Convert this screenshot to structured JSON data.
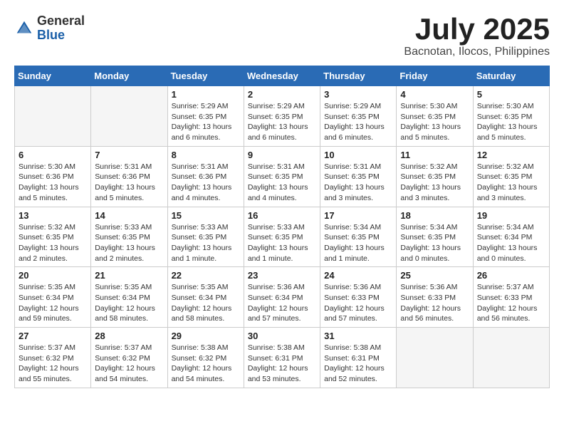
{
  "logo": {
    "general": "General",
    "blue": "Blue"
  },
  "title": "July 2025",
  "location": "Bacnotan, Ilocos, Philippines",
  "weekdays": [
    "Sunday",
    "Monday",
    "Tuesday",
    "Wednesday",
    "Thursday",
    "Friday",
    "Saturday"
  ],
  "weeks": [
    [
      {
        "day": "",
        "info": ""
      },
      {
        "day": "",
        "info": ""
      },
      {
        "day": "1",
        "info": "Sunrise: 5:29 AM\nSunset: 6:35 PM\nDaylight: 13 hours\nand 6 minutes."
      },
      {
        "day": "2",
        "info": "Sunrise: 5:29 AM\nSunset: 6:35 PM\nDaylight: 13 hours\nand 6 minutes."
      },
      {
        "day": "3",
        "info": "Sunrise: 5:29 AM\nSunset: 6:35 PM\nDaylight: 13 hours\nand 6 minutes."
      },
      {
        "day": "4",
        "info": "Sunrise: 5:30 AM\nSunset: 6:35 PM\nDaylight: 13 hours\nand 5 minutes."
      },
      {
        "day": "5",
        "info": "Sunrise: 5:30 AM\nSunset: 6:35 PM\nDaylight: 13 hours\nand 5 minutes."
      }
    ],
    [
      {
        "day": "6",
        "info": "Sunrise: 5:30 AM\nSunset: 6:36 PM\nDaylight: 13 hours\nand 5 minutes."
      },
      {
        "day": "7",
        "info": "Sunrise: 5:31 AM\nSunset: 6:36 PM\nDaylight: 13 hours\nand 5 minutes."
      },
      {
        "day": "8",
        "info": "Sunrise: 5:31 AM\nSunset: 6:36 PM\nDaylight: 13 hours\nand 4 minutes."
      },
      {
        "day": "9",
        "info": "Sunrise: 5:31 AM\nSunset: 6:35 PM\nDaylight: 13 hours\nand 4 minutes."
      },
      {
        "day": "10",
        "info": "Sunrise: 5:31 AM\nSunset: 6:35 PM\nDaylight: 13 hours\nand 3 minutes."
      },
      {
        "day": "11",
        "info": "Sunrise: 5:32 AM\nSunset: 6:35 PM\nDaylight: 13 hours\nand 3 minutes."
      },
      {
        "day": "12",
        "info": "Sunrise: 5:32 AM\nSunset: 6:35 PM\nDaylight: 13 hours\nand 3 minutes."
      }
    ],
    [
      {
        "day": "13",
        "info": "Sunrise: 5:32 AM\nSunset: 6:35 PM\nDaylight: 13 hours\nand 2 minutes."
      },
      {
        "day": "14",
        "info": "Sunrise: 5:33 AM\nSunset: 6:35 PM\nDaylight: 13 hours\nand 2 minutes."
      },
      {
        "day": "15",
        "info": "Sunrise: 5:33 AM\nSunset: 6:35 PM\nDaylight: 13 hours\nand 1 minute."
      },
      {
        "day": "16",
        "info": "Sunrise: 5:33 AM\nSunset: 6:35 PM\nDaylight: 13 hours\nand 1 minute."
      },
      {
        "day": "17",
        "info": "Sunrise: 5:34 AM\nSunset: 6:35 PM\nDaylight: 13 hours\nand 1 minute."
      },
      {
        "day": "18",
        "info": "Sunrise: 5:34 AM\nSunset: 6:35 PM\nDaylight: 13 hours\nand 0 minutes."
      },
      {
        "day": "19",
        "info": "Sunrise: 5:34 AM\nSunset: 6:34 PM\nDaylight: 13 hours\nand 0 minutes."
      }
    ],
    [
      {
        "day": "20",
        "info": "Sunrise: 5:35 AM\nSunset: 6:34 PM\nDaylight: 12 hours\nand 59 minutes."
      },
      {
        "day": "21",
        "info": "Sunrise: 5:35 AM\nSunset: 6:34 PM\nDaylight: 12 hours\nand 58 minutes."
      },
      {
        "day": "22",
        "info": "Sunrise: 5:35 AM\nSunset: 6:34 PM\nDaylight: 12 hours\nand 58 minutes."
      },
      {
        "day": "23",
        "info": "Sunrise: 5:36 AM\nSunset: 6:34 PM\nDaylight: 12 hours\nand 57 minutes."
      },
      {
        "day": "24",
        "info": "Sunrise: 5:36 AM\nSunset: 6:33 PM\nDaylight: 12 hours\nand 57 minutes."
      },
      {
        "day": "25",
        "info": "Sunrise: 5:36 AM\nSunset: 6:33 PM\nDaylight: 12 hours\nand 56 minutes."
      },
      {
        "day": "26",
        "info": "Sunrise: 5:37 AM\nSunset: 6:33 PM\nDaylight: 12 hours\nand 56 minutes."
      }
    ],
    [
      {
        "day": "27",
        "info": "Sunrise: 5:37 AM\nSunset: 6:32 PM\nDaylight: 12 hours\nand 55 minutes."
      },
      {
        "day": "28",
        "info": "Sunrise: 5:37 AM\nSunset: 6:32 PM\nDaylight: 12 hours\nand 54 minutes."
      },
      {
        "day": "29",
        "info": "Sunrise: 5:38 AM\nSunset: 6:32 PM\nDaylight: 12 hours\nand 54 minutes."
      },
      {
        "day": "30",
        "info": "Sunrise: 5:38 AM\nSunset: 6:31 PM\nDaylight: 12 hours\nand 53 minutes."
      },
      {
        "day": "31",
        "info": "Sunrise: 5:38 AM\nSunset: 6:31 PM\nDaylight: 12 hours\nand 52 minutes."
      },
      {
        "day": "",
        "info": ""
      },
      {
        "day": "",
        "info": ""
      }
    ]
  ]
}
